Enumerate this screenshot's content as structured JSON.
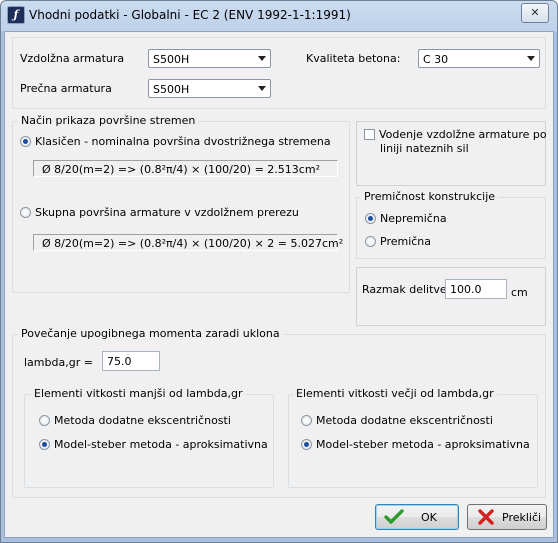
{
  "window": {
    "title": "Vhodni podatki - Globalni - EC 2 (ENV 1992-1-1:1991)",
    "close_label": "✕"
  },
  "reinforcement": {
    "longitudinal_label": "Vzdolžna armatura",
    "longitudinal_value": "S500H",
    "transverse_label": "Prečna armatura",
    "transverse_value": "S500H",
    "concrete_label": "Kvaliteta betona:",
    "concrete_value": "C 30"
  },
  "stirrups": {
    "legend": "Način prikaza površine stremen",
    "options": [
      {
        "label": "Klasičen - nominalna površina dvostrižnega stremena",
        "selected": true
      },
      {
        "label": "Skupna površina armature v vzdolžnem prerezu",
        "selected": false
      }
    ],
    "formula1": "Ø 8/20(m=2) => (0.8²π/4) × (100/20) = 2.513cm²",
    "formula2": "Ø 8/20(m=2) => (0.8²π/4) × (100/20) × 2 = 5.027cm²"
  },
  "tension_lines": {
    "label_line1": "Vodenje vzdolžne armature po",
    "label_line2": "liniji nateznih sil",
    "checked": false
  },
  "mobility": {
    "legend": "Premičnost konstrukcije",
    "options": [
      {
        "label": "Nepremična",
        "selected": true
      },
      {
        "label": "Premična",
        "selected": false
      }
    ]
  },
  "division": {
    "label": "Razmak delitve",
    "value": "100.0",
    "unit": "cm"
  },
  "buckling": {
    "legend": "Povečanje upogibnega momenta zaradi uklona",
    "lambda_label": "lambda,gr =",
    "lambda_value": "75.0",
    "lower": {
      "legend": "Elementi vitkosti manjši od lambda,gr",
      "options": [
        {
          "label": "Metoda dodatne ekscentričnosti",
          "selected": false
        },
        {
          "label": "Model-steber metoda - aproksimativna",
          "selected": true
        }
      ]
    },
    "higher": {
      "legend": "Elementi vitkosti večji od lambda,gr",
      "options": [
        {
          "label": "Metoda dodatne ekscentričnosti",
          "selected": false
        },
        {
          "label": "Model-steber metoda - aproksimativna",
          "selected": true
        }
      ]
    }
  },
  "buttons": {
    "ok_label": "OK",
    "cancel_label": "Prekliči"
  },
  "colors": {
    "ok_icon": "#2e9a2e",
    "cancel_icon": "#d32020",
    "selection": "#1a4d9e"
  }
}
